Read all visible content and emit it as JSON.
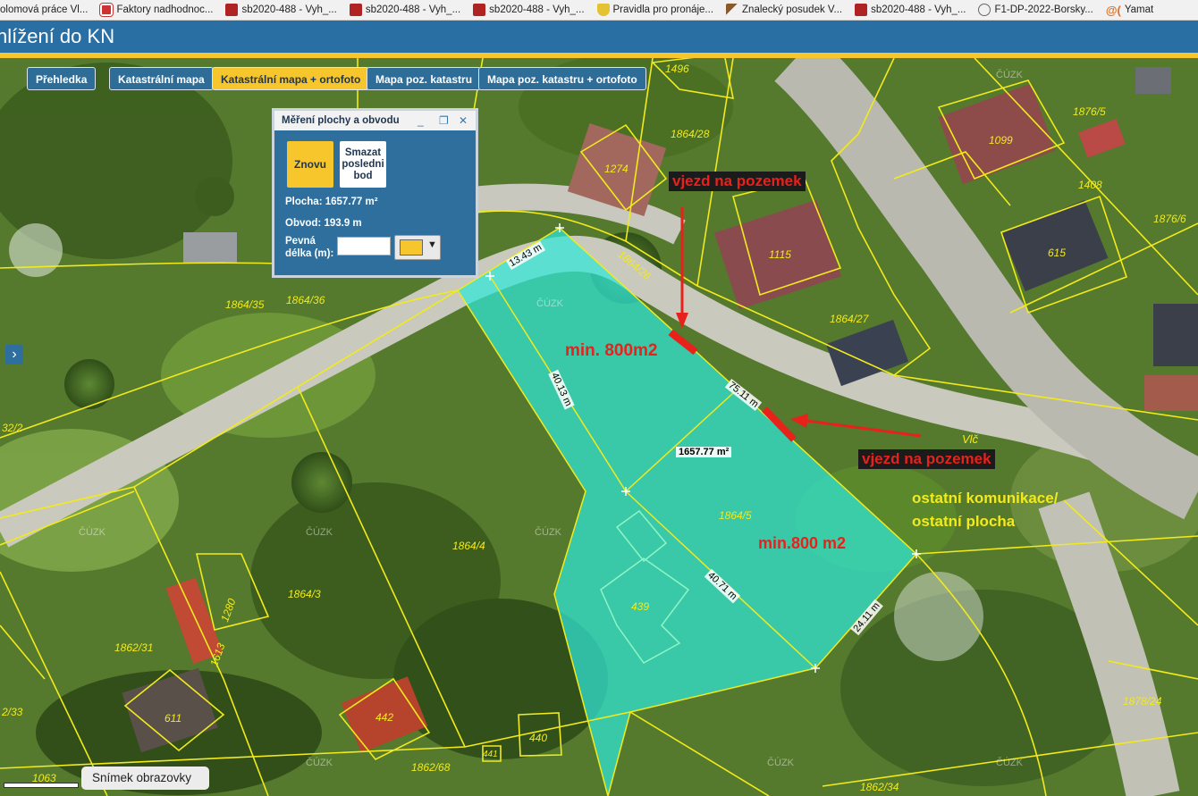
{
  "bookmarks": [
    {
      "label": "olomová práce Vl...",
      "icon": "none"
    },
    {
      "label": "Faktory nadhodnoc...",
      "icon": "red-square-icon"
    },
    {
      "label": "sb2020-488 - Vyh_...",
      "icon": "seal-icon"
    },
    {
      "label": "sb2020-488 - Vyh_...",
      "icon": "seal-icon"
    },
    {
      "label": "sb2020-488 - Vyh_...",
      "icon": "seal-icon"
    },
    {
      "label": "Pravidla pro pronáje...",
      "icon": "shield-icon"
    },
    {
      "label": "Znalecký posudek V...",
      "icon": "hammer-icon"
    },
    {
      "label": "sb2020-488 - Vyh_...",
      "icon": "seal-icon"
    },
    {
      "label": "F1-DP-2022-Borsky...",
      "icon": "globe-icon"
    },
    {
      "label": "Yamat",
      "icon": "at-icon"
    }
  ],
  "header": {
    "title": "hlížení do KN"
  },
  "tabs": [
    {
      "label": "Přehledka",
      "active": false
    },
    {
      "label": "Katastrální mapa",
      "active": false
    },
    {
      "label": "Katastrální mapa + ortofoto",
      "active": true
    },
    {
      "label": "Mapa poz. katastru",
      "active": false
    },
    {
      "label": "Mapa poz. katastru + ortofoto",
      "active": false
    }
  ],
  "panel": {
    "title": "Měření plochy a obvodu",
    "restart_label": "Znovu",
    "delete_label": "Smazat posledni bod",
    "area_text": "Plocha: 1657.77 m²",
    "perimeter_text": "Obvod: 193.9 m",
    "fixed_length_label": "Pevná délka (m):",
    "fixed_length_value": "",
    "selected_color": "#f6c62c"
  },
  "map": {
    "watermark": "ČÚZK",
    "measurement_labels": [
      "13.43 m",
      "40.13 m",
      "75.11 m",
      "1657.77 m²",
      "40.71 m",
      "24.11 m"
    ],
    "parcel_labels": [
      "1496",
      "1864/28",
      "1274",
      "1099",
      "1876/5",
      "1408",
      "1876/6",
      "615",
      "1115",
      "1864/26",
      "1864/27",
      "1864/35",
      "1864/36",
      "1864/5",
      "1864/4",
      "1864/3",
      "1862/31",
      "1280",
      "1613",
      "611",
      "442",
      "440",
      "441",
      "439",
      "1862/68",
      "1063",
      "1862/34",
      "1878/24",
      "32/2",
      "2/33",
      "Vlč"
    ],
    "annotations": {
      "access_top": "vjezd na pozemek",
      "access_right": "vjezd na pozemek",
      "min_top": "min. 800m2",
      "min_right": "min.800 m2",
      "road_note_1": "ostatní komunikace/",
      "road_note_2": "ostatní plocha"
    },
    "colors": {
      "parcel_line": "#f2ea1c",
      "measure_fill": "#2fe8d8",
      "annotation_red": "#e8211b"
    }
  },
  "footer": {
    "screenshot_label": "Snímek obrazovky"
  }
}
